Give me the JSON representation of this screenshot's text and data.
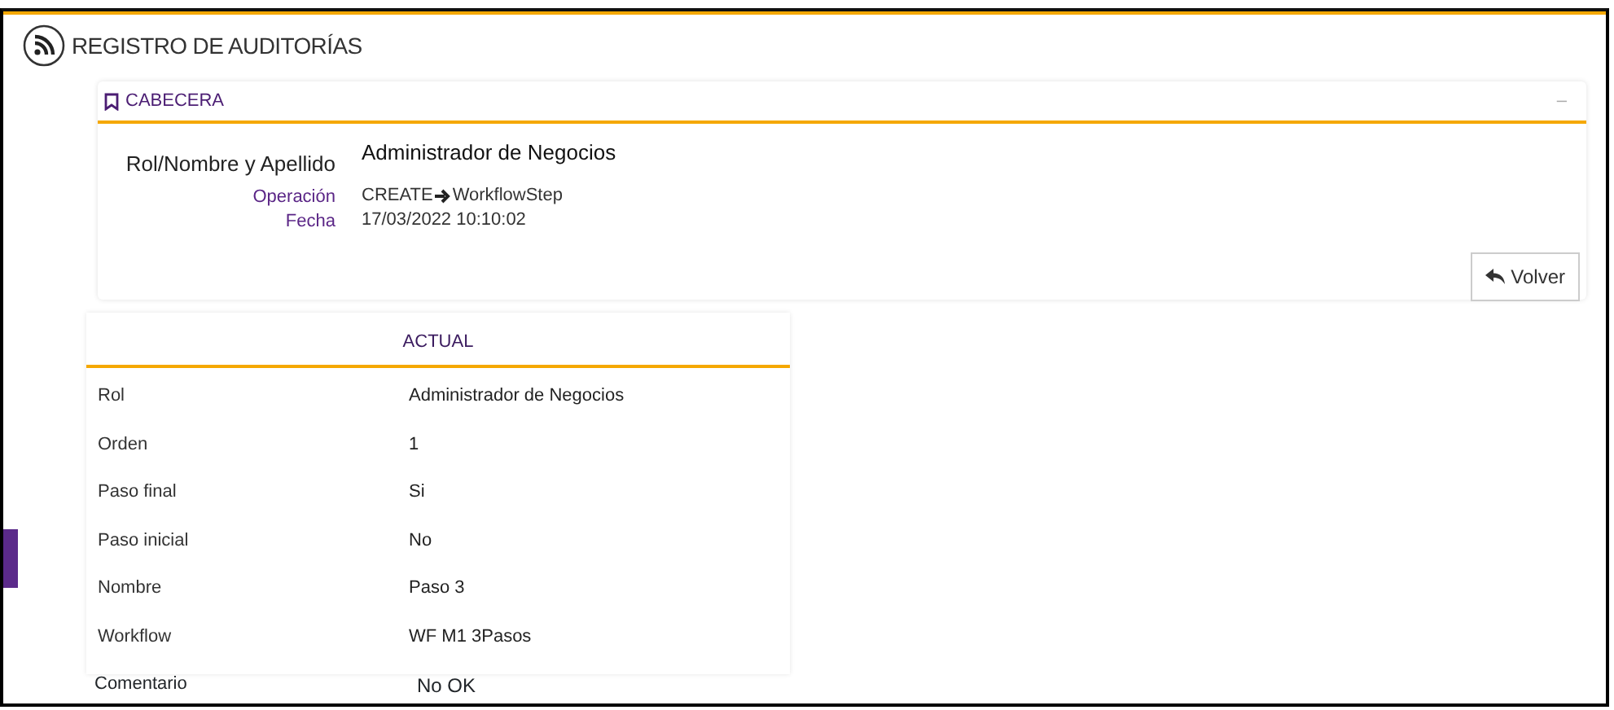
{
  "page": {
    "title": "REGISTRO DE AUDITORÍAS"
  },
  "header_card": {
    "title": "CABECERA",
    "collapse": "–",
    "main_field": {
      "label": "Rol/Nombre y Apellido",
      "value": "Administrador de Negocios"
    },
    "fields": [
      {
        "label": "Operación",
        "value": "CREATE",
        "target": "WorkflowStep"
      },
      {
        "label": "Fecha",
        "value": "17/03/2022 10:10:02"
      }
    ],
    "button": "Volver"
  },
  "actual_card": {
    "title": "ACTUAL",
    "rows": [
      {
        "label": "Rol",
        "value": "Administrador de Negocios"
      },
      {
        "label": "Orden",
        "value": "1"
      },
      {
        "label": "Paso final",
        "value": "Si"
      },
      {
        "label": "Paso inicial",
        "value": "No"
      },
      {
        "label": "Nombre",
        "value": "Paso 3"
      },
      {
        "label": "Workflow",
        "value": "WF M1 3Pasos"
      }
    ]
  },
  "comment": {
    "label": "Comentario",
    "value": "No OK"
  }
}
